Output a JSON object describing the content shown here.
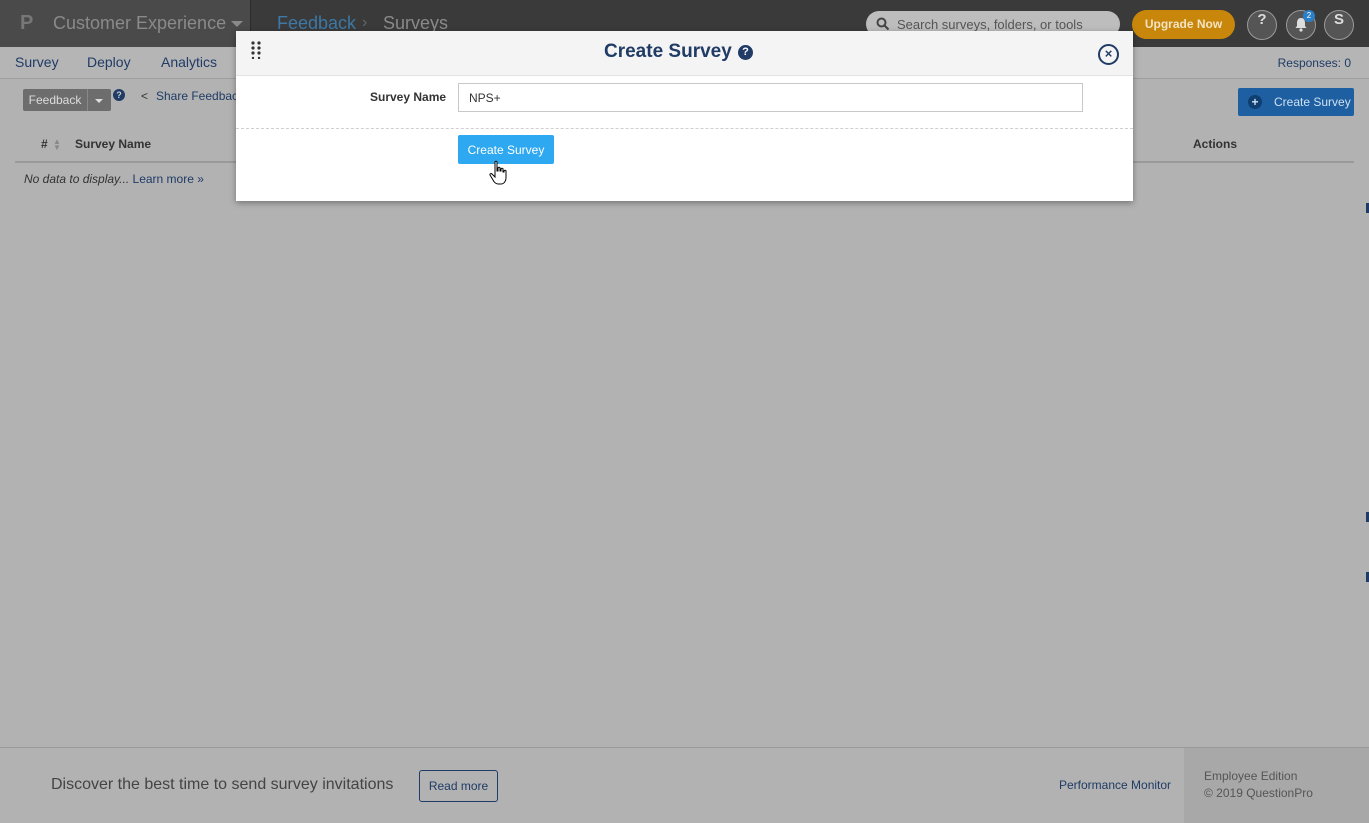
{
  "topbar": {
    "brand_logo": "P",
    "brand_name": "Customer Experience",
    "breadcrumb": [
      "Feedback",
      "Surveys"
    ],
    "breadcrumb_separator": "›",
    "search_placeholder": "Search surveys, folders, or tools",
    "upgrade_label": "Upgrade Now",
    "help_label": "?",
    "notification_count": "2",
    "user_initial": "S"
  },
  "subnav": {
    "items": [
      "Survey",
      "Deploy",
      "Analytics"
    ],
    "responses": "Responses: 0"
  },
  "toolbar": {
    "feedback_label": "Feedback",
    "help_label": "?",
    "share_label": "Share Feedback",
    "create_label": "Create Survey",
    "create_plus": "+"
  },
  "table": {
    "columns": [
      "#",
      "Survey Name",
      "Actions"
    ],
    "empty_text": "No data to display...",
    "learn_more": "Learn more »"
  },
  "footer": {
    "discover_text": "Discover the best time to send survey invitations",
    "read_more": "Read more",
    "performance_monitor": "Performance Monitor",
    "edition": "Employee Edition",
    "copyright": "© 2019 QuestionPro"
  },
  "modal": {
    "title": "Create Survey",
    "help_label": "?",
    "close_label": "×",
    "field_label": "Survey Name",
    "field_value": "NPS+",
    "submit_label": "Create Survey"
  },
  "colors": {
    "topbar": "#3a3a3a",
    "overlay": "#b2b2b2",
    "brand_navy": "#1f3b66",
    "upgrade": "#c8870a",
    "primary_button": "#2ea8f0"
  },
  "icons": [
    "brand-logo-icon",
    "chevron-down-icon",
    "search-icon",
    "help-icon",
    "bell-icon",
    "share-icon",
    "plus-icon",
    "sort-icon",
    "drag-handle-icon",
    "close-icon",
    "hand-cursor-icon"
  ]
}
